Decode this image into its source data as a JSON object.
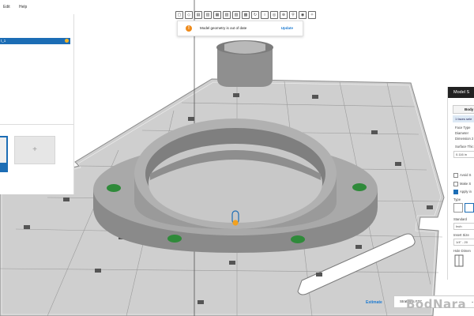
{
  "menu": {
    "items": [
      "Edit",
      "Help"
    ]
  },
  "toolbar": {
    "tools": [
      "box",
      "cube",
      "stack",
      "layers",
      "frame",
      "sheet",
      "fit",
      "view",
      "rotate",
      "globe",
      "target",
      "zoom",
      "search",
      "eye",
      "magic"
    ]
  },
  "notice": {
    "icon": "warning-icon",
    "message": "Model geometry is out of date",
    "action": "Update",
    "color": "#ee8a1a"
  },
  "left_panel": {
    "selected_item": "t_1",
    "add_symbol": "+",
    "accent": "#1c6db5"
  },
  "right_panel": {
    "title": "Model S",
    "body_tab": "Body",
    "faces_selected": "1 faces sele",
    "face_type_label": "Face Type",
    "diameter_label": "Diameter",
    "dimension_label": "Dimension 2",
    "surface_label": "Surface Thic",
    "surface_value": "0.116 in",
    "avoid_label": "Avoid S",
    "make_label": "Make S",
    "apply_label": "Apply in",
    "type_label": "Type",
    "standard_label": "Standard",
    "standard_value": "Inch",
    "insert_size_label": "Insert Size",
    "insert_size_value": "1/4\" - 20",
    "hole_dims_label": "Hole Dimen"
  },
  "bottom": {
    "estimate_label": "Estimate",
    "printer": "Stratasys F37",
    "printer_chevron": "⌄"
  },
  "watermark": "BodNara",
  "colors": {
    "part": "#a7a7a7",
    "insert": "#2f8a3a",
    "plate": "#cfcfcf",
    "highlight": "#1c6db5"
  }
}
